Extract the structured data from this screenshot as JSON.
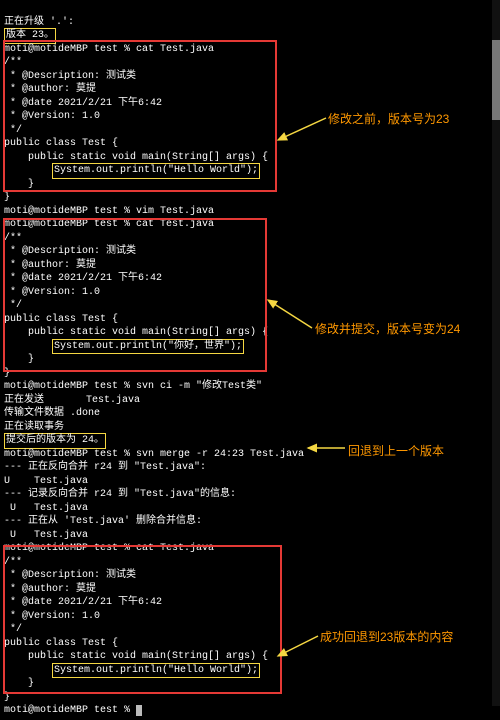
{
  "upgrade_line": "正在升级 '.':",
  "version_label": "版本 23。",
  "prompt": "moti@motideMBP test % ",
  "cat_test": "cat Test.java",
  "vim_test": "vim Test.java",
  "ci_cmd": "svn ci -m \"修改Test类\"",
  "merge_cmd": "svn merge -r 24:23 Test.java",
  "java_header": {
    "l1": "/**",
    "l2": " * @Description: 测试类",
    "l3": " * @author: 莫提",
    "l4": " * @date 2021/2/21 下午6:42",
    "l5": " * @Version: 1.0",
    "l6": " */",
    "l7": "public class Test {",
    "l8": "    public static void main(String[] args) {",
    "l10": "    }",
    "l11": "}"
  },
  "println_hello": "System.out.println(\"Hello World\");",
  "println_nihao": "System.out.println(\"你好，世界\");",
  "ci_out": {
    "l1": "正在发送       Test.java",
    "l2": "传输文件数据 .done",
    "l3": "正在读取事务",
    "l4": "提交后的版本为 24。"
  },
  "merge_out": {
    "l1": "--- 正在反向合并 r24 到 \"Test.java\":",
    "l2": "U    Test.java",
    "l3": "--- 记录反向合并 r24 到 \"Test.java\"的信息:",
    "l4": " U   Test.java",
    "l5": "--- 正在从 'Test.java' 删除合并信息:",
    "l6": " U   Test.java"
  },
  "annot": {
    "before": "修改之前，版本号为23",
    "after_commit": "修改并提交，版本号变为24",
    "rollback": "回退到上一个版本",
    "success": "成功回退到23版本的内容"
  }
}
